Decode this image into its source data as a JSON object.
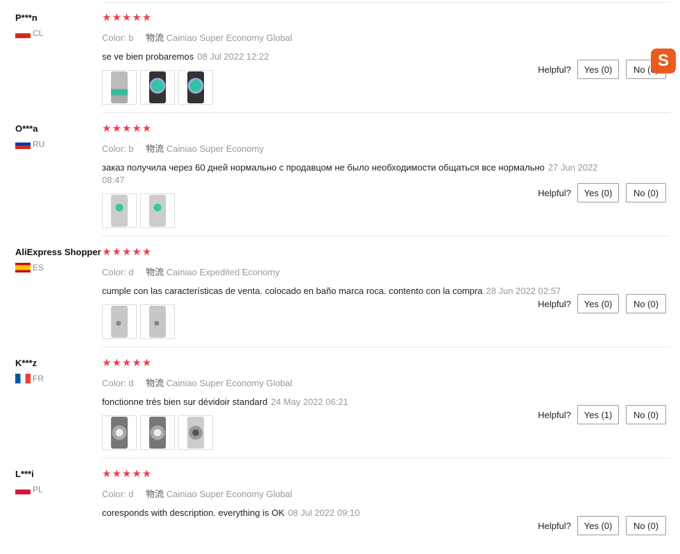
{
  "helpful_label": "Helpful?",
  "shipping_label": "物流",
  "overlay": {
    "logo_text": "S"
  },
  "reviews": [
    {
      "name": "P***n",
      "country": "CL",
      "rating": 5,
      "color": "Color: b",
      "shipping": "Cainiao Super Economy Global",
      "text": "se ve bien probaremos",
      "date": "08 Jul 2022 12:22",
      "yes": "Yes (0)",
      "no": "No (0)",
      "thumbs": [
        "teal-bottle",
        "teal-closeup",
        "teal-closeup"
      ]
    },
    {
      "name": "O***a",
      "country": "RU",
      "rating": 5,
      "color": "Color: b",
      "shipping": "Cainiao Super Economy",
      "text": "заказ получила через 60 дней нормально с продавцом не было необходимости общаться все нормально",
      "date": "27 Jun 2022 08:47",
      "yes": "Yes (0)",
      "no": "No (0)",
      "thumbs": [
        "gray-bottle",
        "gray-bottle"
      ]
    },
    {
      "name": "AliExpress Shopper",
      "country": "ES",
      "rating": 5,
      "color": "Color: d",
      "shipping": "Cainiao Expedited Economy",
      "text": "cumple con las características de venta. colocado en baño marca roca. contento con la compra",
      "date": "28 Jun 2022 02:57",
      "yes": "Yes (0)",
      "no": "No (0)",
      "thumbs": [
        "gray-surface",
        "gray-surface"
      ]
    },
    {
      "name": "K***z",
      "country": "FR",
      "rating": 5,
      "color": "Color: d",
      "shipping": "Cainiao Super Economy Global",
      "text": "fonctionne très bien sur dévidoir standard",
      "date": "24 May 2022 06:21",
      "yes": "Yes (1)",
      "no": "No (0)",
      "thumbs": [
        "gray-disc",
        "gray-disc",
        "dark-disc"
      ]
    },
    {
      "name": "L***i",
      "country": "PL",
      "rating": 5,
      "color": "Color: d",
      "shipping": "Cainiao Super Economy Global",
      "text": "coresponds with description. everything is OK",
      "date": "08 Jul 2022 09:10",
      "yes": "Yes (0)",
      "no": "No (0)",
      "thumbs": []
    }
  ]
}
